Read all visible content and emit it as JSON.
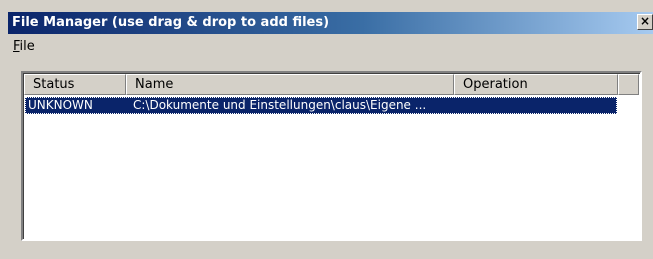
{
  "window": {
    "title": "File Manager (use drag & drop to add files)",
    "close_label": "×"
  },
  "menu": {
    "items": [
      {
        "label_mnemonic": "F",
        "label_rest": "ile"
      }
    ]
  },
  "table": {
    "columns": [
      "Status",
      "Name",
      "Operation"
    ],
    "rows": [
      {
        "status": "UNKNOWN",
        "name": "C:\\Dokumente und Einstellungen\\claus\\Eigene ...",
        "operation": "",
        "selected": true
      }
    ]
  },
  "colors": {
    "title_gradient_start": "#0a246a",
    "title_gradient_end": "#a6caf0",
    "selection": "#0a246a",
    "face": "#d4d0c8"
  }
}
